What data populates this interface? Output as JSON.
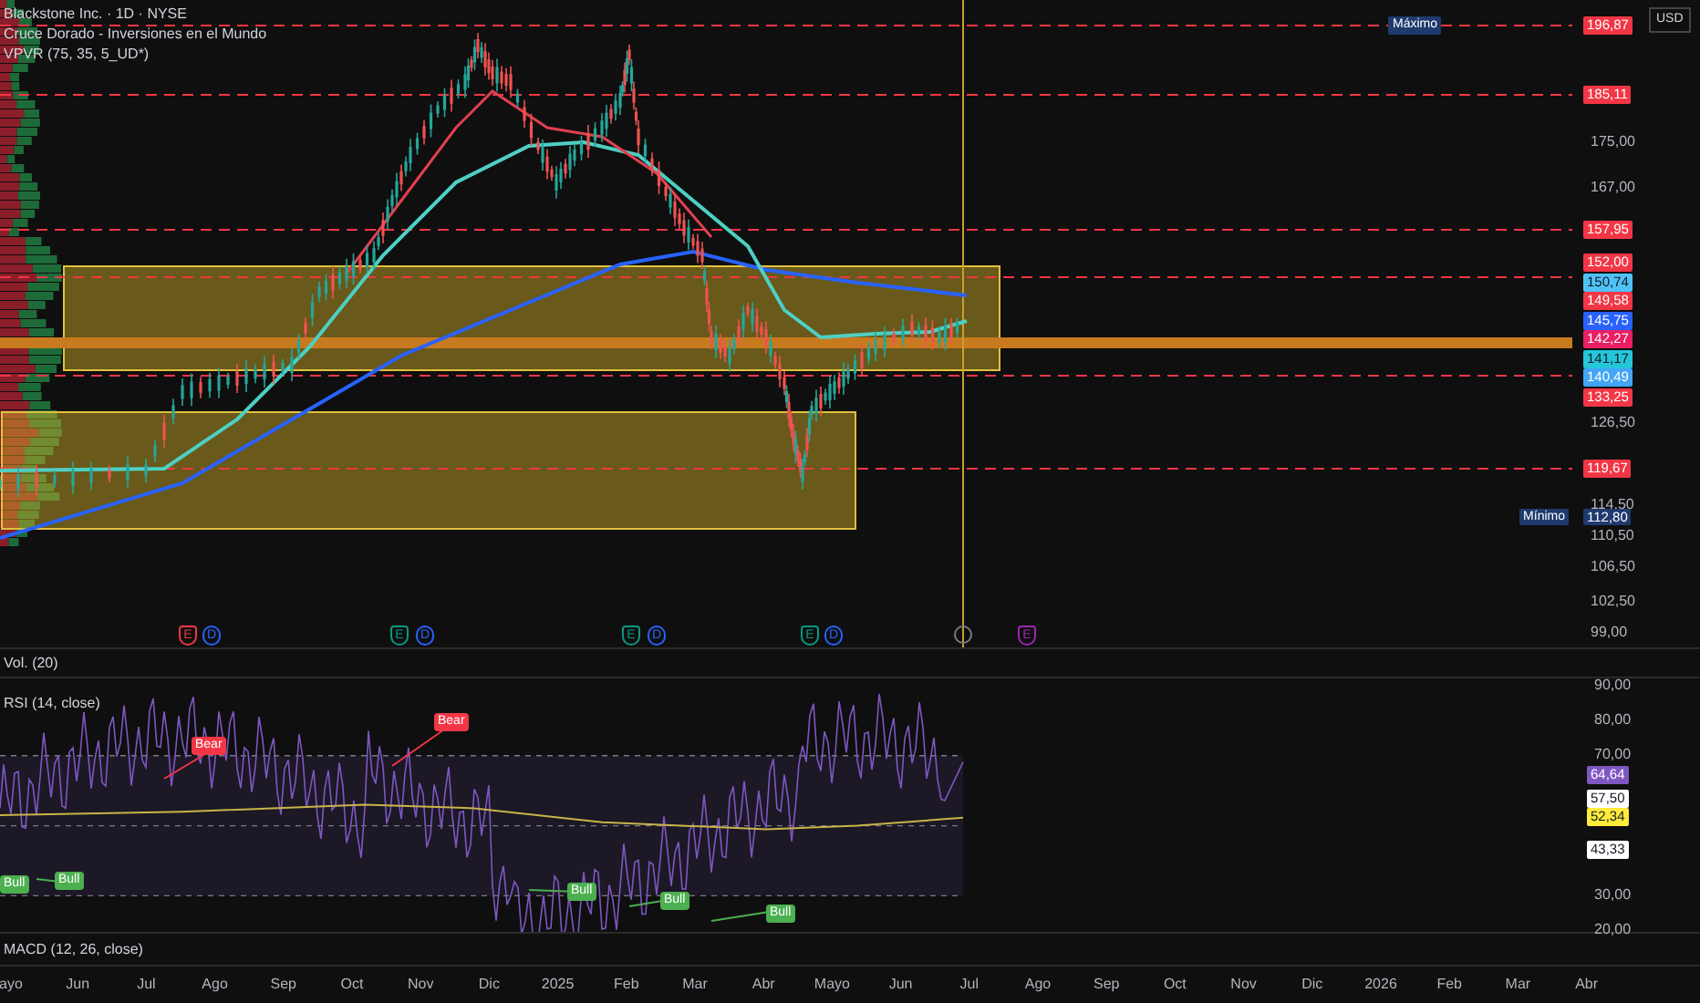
{
  "legend": {
    "symbol": "Blackstone Inc. · 1D · NYSE",
    "study": "Cruce Dorado - Inversiones en el Mundo",
    "profile": "VPVR (75, 35, 5_UD*)"
  },
  "currency": "USD",
  "price_axis": {
    "ticks": [
      "175,00",
      "167,00",
      "126,50",
      "114,50",
      "110,50",
      "106,50",
      "102,50",
      "99,00"
    ],
    "tags": [
      {
        "text": "196,87",
        "color": "#f23645"
      },
      {
        "text": "185,11",
        "color": "#f23645"
      },
      {
        "text": "157,95",
        "color": "#f23645"
      },
      {
        "text": "152,00",
        "color": "#f23645"
      },
      {
        "text": "150,74",
        "color": "#4fc3f7"
      },
      {
        "text": "149,58",
        "color": "#f23645"
      },
      {
        "text": "145,75",
        "color": "#2962ff"
      },
      {
        "text": "142,27",
        "color": "#e91e63"
      },
      {
        "text": "141,17",
        "color": "#26c6da"
      },
      {
        "text": "140,49",
        "color": "#42a5f5"
      },
      {
        "text": "133,25",
        "color": "#f23645"
      },
      {
        "text": "119,67",
        "color": "#f23645"
      }
    ],
    "max": {
      "label": "Máximo"
    },
    "min": {
      "label": "Mínimo",
      "value": "112,80"
    }
  },
  "events": [
    {
      "kind": "earnings",
      "letter": "E",
      "color": "#f23645"
    },
    {
      "kind": "dividend",
      "letter": "D",
      "color": "#2962ff"
    },
    {
      "kind": "earnings",
      "letter": "E",
      "color": "#089981"
    },
    {
      "kind": "dividend",
      "letter": "D",
      "color": "#2962ff"
    },
    {
      "kind": "earnings",
      "letter": "E",
      "color": "#089981"
    },
    {
      "kind": "dividend",
      "letter": "D",
      "color": "#2962ff"
    },
    {
      "kind": "earnings",
      "letter": "E",
      "color": "#089981"
    },
    {
      "kind": "dividend",
      "letter": "D",
      "color": "#2962ff"
    },
    {
      "kind": "earnings",
      "letter": "E",
      "color": "#9c27b0"
    }
  ],
  "volume_pane": {
    "title": "Vol. (20)"
  },
  "rsi_pane": {
    "title": "RSI (14, close)",
    "ticks": [
      "90,00",
      "80,00",
      "70,00",
      "30,00",
      "20,00"
    ],
    "tags": [
      {
        "text": "64,64",
        "color": "#7e57c2"
      },
      {
        "text": "57,50",
        "color": "#ffffff"
      },
      {
        "text": "52,34",
        "color": "#ffeb3b"
      },
      {
        "text": "43,33",
        "color": "#ffffff"
      }
    ],
    "divergences": [
      {
        "kind": "bear",
        "label": "Bear"
      },
      {
        "kind": "bear",
        "label": "Bear"
      },
      {
        "kind": "bull",
        "label": "Bull"
      },
      {
        "kind": "bull",
        "label": "Bull"
      },
      {
        "kind": "bull",
        "label": "Bull"
      },
      {
        "kind": "bull",
        "label": "Bull"
      },
      {
        "kind": "bull",
        "label": "Bull"
      }
    ]
  },
  "macd_pane": {
    "title": "MACD (12, 26, close)"
  },
  "time_axis": [
    "ayo",
    "Jun",
    "Jul",
    "Ago",
    "Sep",
    "Oct",
    "Nov",
    "Dic",
    "2025",
    "Feb",
    "Mar",
    "Abr",
    "Mayo",
    "Jun",
    "Jul",
    "Ago",
    "Sep",
    "Oct",
    "Nov",
    "Dic",
    "2026",
    "Feb",
    "Mar",
    "Abr"
  ]
}
